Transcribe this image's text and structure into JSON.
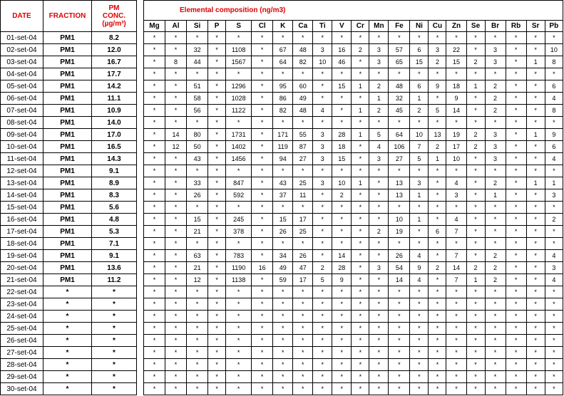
{
  "left": {
    "date_header": "DATE",
    "fraction_header": "FRACTION",
    "conc_header_line1": "PM",
    "conc_header_line2": "CONC.",
    "conc_header_line3": "(µg/m³)"
  },
  "right": {
    "title": "Elemental composition (ng/m3)",
    "columns": [
      "Mg",
      "Al",
      "Si",
      "P",
      "S",
      "Cl",
      "K",
      "Ca",
      "Ti",
      "V",
      "Cr",
      "Mn",
      "Fe",
      "Ni",
      "Cu",
      "Zn",
      "Se",
      "Br",
      "Rb",
      "Sr",
      "Pb"
    ]
  },
  "rows": [
    {
      "date": "01-set-04",
      "fraction": "PM1",
      "conc": "8.2",
      "values": [
        "*",
        "*",
        "*",
        "*",
        "*",
        "*",
        "*",
        "*",
        "*",
        "*",
        "*",
        "*",
        "*",
        "*",
        "*",
        "*",
        "*",
        "*",
        "*",
        "*",
        "*"
      ]
    },
    {
      "date": "02-set-04",
      "fraction": "PM1",
      "conc": "12.0",
      "values": [
        "*",
        "*",
        "32",
        "*",
        "1108",
        "*",
        "67",
        "48",
        "3",
        "16",
        "2",
        "3",
        "57",
        "6",
        "3",
        "22",
        "*",
        "3",
        "*",
        "*",
        "10"
      ]
    },
    {
      "date": "03-set-04",
      "fraction": "PM1",
      "conc": "16.7",
      "values": [
        "*",
        "8",
        "44",
        "*",
        "1567",
        "*",
        "64",
        "82",
        "10",
        "46",
        "*",
        "3",
        "65",
        "15",
        "2",
        "15",
        "2",
        "3",
        "*",
        "1",
        "8"
      ]
    },
    {
      "date": "04-set-04",
      "fraction": "PM1",
      "conc": "17.7",
      "values": [
        "*",
        "*",
        "*",
        "*",
        "*",
        "*",
        "*",
        "*",
        "*",
        "*",
        "*",
        "*",
        "*",
        "*",
        "*",
        "*",
        "*",
        "*",
        "*",
        "*",
        "*"
      ]
    },
    {
      "date": "05-set-04",
      "fraction": "PM1",
      "conc": "14.2",
      "values": [
        "*",
        "*",
        "51",
        "*",
        "1296",
        "*",
        "95",
        "60",
        "*",
        "15",
        "1",
        "2",
        "48",
        "6",
        "9",
        "18",
        "1",
        "2",
        "*",
        "*",
        "6"
      ]
    },
    {
      "date": "06-set-04",
      "fraction": "PM1",
      "conc": "11.1",
      "values": [
        "*",
        "*",
        "58",
        "*",
        "1028",
        "*",
        "86",
        "49",
        "*",
        "*",
        "*",
        "1",
        "32",
        "1",
        "*",
        "9",
        "*",
        "2",
        "*",
        "*",
        "4"
      ]
    },
    {
      "date": "07-set-04",
      "fraction": "PM1",
      "conc": "10.9",
      "values": [
        "*",
        "*",
        "56",
        "*",
        "1122",
        "*",
        "82",
        "48",
        "4",
        "*",
        "1",
        "2",
        "45",
        "2",
        "5",
        "14",
        "*",
        "2",
        "*",
        "*",
        "8"
      ]
    },
    {
      "date": "08-set-04",
      "fraction": "PM1",
      "conc": "14.0",
      "values": [
        "*",
        "*",
        "*",
        "*",
        "*",
        "*",
        "*",
        "*",
        "*",
        "*",
        "*",
        "*",
        "*",
        "*",
        "*",
        "*",
        "*",
        "*",
        "*",
        "*",
        "*"
      ]
    },
    {
      "date": "09-set-04",
      "fraction": "PM1",
      "conc": "17.0",
      "values": [
        "*",
        "14",
        "80",
        "*",
        "1731",
        "*",
        "171",
        "55",
        "3",
        "28",
        "1",
        "5",
        "64",
        "10",
        "13",
        "19",
        "2",
        "3",
        "*",
        "1",
        "9"
      ]
    },
    {
      "date": "10-set-04",
      "fraction": "PM1",
      "conc": "16.5",
      "values": [
        "*",
        "12",
        "50",
        "*",
        "1402",
        "*",
        "119",
        "87",
        "3",
        "18",
        "*",
        "4",
        "106",
        "7",
        "2",
        "17",
        "2",
        "3",
        "*",
        "*",
        "6"
      ]
    },
    {
      "date": "11-set-04",
      "fraction": "PM1",
      "conc": "14.3",
      "values": [
        "*",
        "*",
        "43",
        "*",
        "1456",
        "*",
        "94",
        "27",
        "3",
        "15",
        "*",
        "3",
        "27",
        "5",
        "1",
        "10",
        "*",
        "3",
        "*",
        "*",
        "4"
      ]
    },
    {
      "date": "12-set-04",
      "fraction": "PM1",
      "conc": "9.1",
      "values": [
        "*",
        "*",
        "*",
        "*",
        "*",
        "*",
        "*",
        "*",
        "*",
        "*",
        "*",
        "*",
        "*",
        "*",
        "*",
        "*",
        "*",
        "*",
        "*",
        "*",
        "*"
      ]
    },
    {
      "date": "13-set-04",
      "fraction": "PM1",
      "conc": "8.9",
      "values": [
        "*",
        "*",
        "33",
        "*",
        "847",
        "*",
        "43",
        "25",
        "3",
        "10",
        "1",
        "*",
        "13",
        "3",
        "*",
        "4",
        "*",
        "2",
        "*",
        "1",
        "1"
      ]
    },
    {
      "date": "14-set-04",
      "fraction": "PM1",
      "conc": "8.3",
      "values": [
        "*",
        "*",
        "26",
        "*",
        "592",
        "*",
        "37",
        "11",
        "*",
        "2",
        "*",
        "*",
        "13",
        "1",
        "*",
        "3",
        "*",
        "1",
        "*",
        "*",
        "3"
      ]
    },
    {
      "date": "15-set-04",
      "fraction": "PM1",
      "conc": "5.6",
      "values": [
        "*",
        "*",
        "*",
        "*",
        "*",
        "*",
        "*",
        "*",
        "*",
        "*",
        "*",
        "*",
        "*",
        "*",
        "*",
        "*",
        "*",
        "*",
        "*",
        "*",
        "*"
      ]
    },
    {
      "date": "16-set-04",
      "fraction": "PM1",
      "conc": "4.8",
      "values": [
        "*",
        "*",
        "15",
        "*",
        "245",
        "*",
        "15",
        "17",
        "*",
        "*",
        "*",
        "*",
        "10",
        "1",
        "*",
        "4",
        "*",
        "*",
        "*",
        "*",
        "2"
      ]
    },
    {
      "date": "17-set-04",
      "fraction": "PM1",
      "conc": "5.3",
      "values": [
        "*",
        "*",
        "21",
        "*",
        "378",
        "*",
        "26",
        "25",
        "*",
        "*",
        "*",
        "2",
        "19",
        "*",
        "6",
        "7",
        "*",
        "*",
        "*",
        "*",
        "*"
      ]
    },
    {
      "date": "18-set-04",
      "fraction": "PM1",
      "conc": "7.1",
      "values": [
        "*",
        "*",
        "*",
        "*",
        "*",
        "*",
        "*",
        "*",
        "*",
        "*",
        "*",
        "*",
        "*",
        "*",
        "*",
        "*",
        "*",
        "*",
        "*",
        "*",
        "*"
      ]
    },
    {
      "date": "19-set-04",
      "fraction": "PM1",
      "conc": "9.1",
      "values": [
        "*",
        "*",
        "63",
        "*",
        "783",
        "*",
        "34",
        "26",
        "*",
        "14",
        "*",
        "*",
        "26",
        "4",
        "*",
        "7",
        "*",
        "2",
        "*",
        "*",
        "4"
      ]
    },
    {
      "date": "20-set-04",
      "fraction": "PM1",
      "conc": "13.6",
      "values": [
        "*",
        "*",
        "21",
        "*",
        "1190",
        "16",
        "49",
        "47",
        "2",
        "28",
        "*",
        "3",
        "54",
        "9",
        "2",
        "14",
        "2",
        "2",
        "*",
        "*",
        "3"
      ]
    },
    {
      "date": "21-set-04",
      "fraction": "PM1",
      "conc": "11.2",
      "values": [
        "*",
        "*",
        "12",
        "*",
        "1138",
        "*",
        "59",
        "17",
        "5",
        "9",
        "*",
        "*",
        "14",
        "4",
        "*",
        "7",
        "1",
        "2",
        "*",
        "*",
        "4"
      ]
    },
    {
      "date": "22-set-04",
      "fraction": "*",
      "conc": "*",
      "values": [
        "*",
        "*",
        "*",
        "*",
        "*",
        "*",
        "*",
        "*",
        "*",
        "*",
        "*",
        "*",
        "*",
        "*",
        "*",
        "*",
        "*",
        "*",
        "*",
        "*",
        "*"
      ]
    },
    {
      "date": "23-set-04",
      "fraction": "*",
      "conc": "*",
      "values": [
        "*",
        "*",
        "*",
        "*",
        "*",
        "*",
        "*",
        "*",
        "*",
        "*",
        "*",
        "*",
        "*",
        "*",
        "*",
        "*",
        "*",
        "*",
        "*",
        "*",
        "*"
      ]
    },
    {
      "date": "24-set-04",
      "fraction": "*",
      "conc": "*",
      "values": [
        "*",
        "*",
        "*",
        "*",
        "*",
        "*",
        "*",
        "*",
        "*",
        "*",
        "*",
        "*",
        "*",
        "*",
        "*",
        "*",
        "*",
        "*",
        "*",
        "*",
        "*"
      ]
    },
    {
      "date": "25-set-04",
      "fraction": "*",
      "conc": "*",
      "values": [
        "*",
        "*",
        "*",
        "*",
        "*",
        "*",
        "*",
        "*",
        "*",
        "*",
        "*",
        "*",
        "*",
        "*",
        "*",
        "*",
        "*",
        "*",
        "*",
        "*",
        "*"
      ]
    },
    {
      "date": "26-set-04",
      "fraction": "*",
      "conc": "*",
      "values": [
        "*",
        "*",
        "*",
        "*",
        "*",
        "*",
        "*",
        "*",
        "*",
        "*",
        "*",
        "*",
        "*",
        "*",
        "*",
        "*",
        "*",
        "*",
        "*",
        "*",
        "*"
      ]
    },
    {
      "date": "27-set-04",
      "fraction": "*",
      "conc": "*",
      "values": [
        "*",
        "*",
        "*",
        "*",
        "*",
        "*",
        "*",
        "*",
        "*",
        "*",
        "*",
        "*",
        "*",
        "*",
        "*",
        "*",
        "*",
        "*",
        "*",
        "*",
        "*"
      ]
    },
    {
      "date": "28-set-04",
      "fraction": "*",
      "conc": "*",
      "values": [
        "*",
        "*",
        "*",
        "*",
        "*",
        "*",
        "*",
        "*",
        "*",
        "*",
        "*",
        "*",
        "*",
        "*",
        "*",
        "*",
        "*",
        "*",
        "*",
        "*",
        "*"
      ]
    },
    {
      "date": "29-set-04",
      "fraction": "*",
      "conc": "*",
      "values": [
        "*",
        "*",
        "*",
        "*",
        "*",
        "*",
        "*",
        "*",
        "*",
        "*",
        "*",
        "*",
        "*",
        "*",
        "*",
        "*",
        "*",
        "*",
        "*",
        "*",
        "*"
      ]
    },
    {
      "date": "30-set-04",
      "fraction": "*",
      "conc": "*",
      "values": [
        "*",
        "*",
        "*",
        "*",
        "*",
        "*",
        "*",
        "*",
        "*",
        "*",
        "*",
        "*",
        "*",
        "*",
        "*",
        "*",
        "*",
        "*",
        "*",
        "*",
        "*"
      ]
    }
  ]
}
